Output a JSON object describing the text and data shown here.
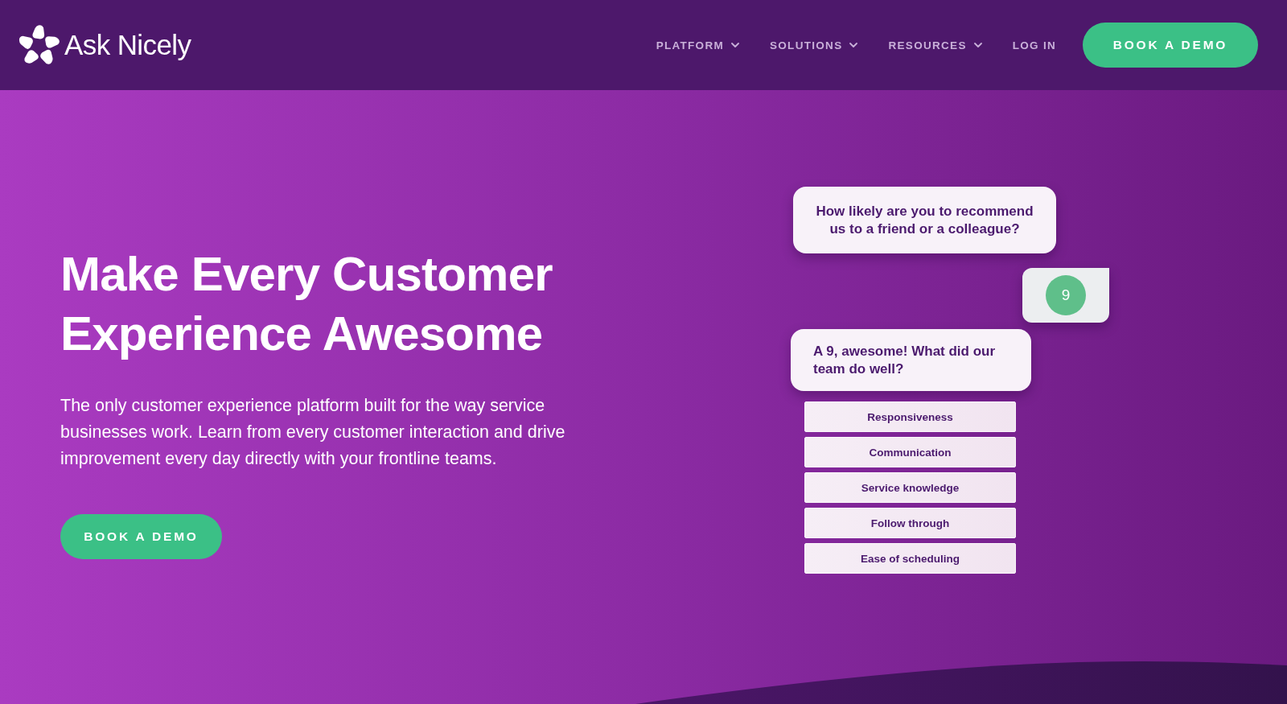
{
  "header": {
    "brand": "Ask Nicely",
    "nav": [
      {
        "label": "PLATFORM",
        "kind": "dropdown"
      },
      {
        "label": "SOLUTIONS",
        "kind": "dropdown"
      },
      {
        "label": "RESOURCES",
        "kind": "dropdown"
      },
      {
        "label": "LOG IN",
        "kind": "link"
      }
    ],
    "cta": "BOOK A DEMO"
  },
  "hero": {
    "heading": "Make Every Customer Experience Awesome",
    "description": "The only customer experience platform built for the way service businesses work. Learn from every customer interaction and drive improvement every day directly with your frontline teams.",
    "cta": "BOOK A DEMO"
  },
  "survey": {
    "question": "How likely are you to recommend us to a friend or a colleague?",
    "score": "9",
    "follow_up": "A 9, awesome! What did our team do well?",
    "options": [
      "Responsiveness",
      "Communication",
      "Service knowledge",
      "Follow through",
      "Ease of scheduling"
    ]
  }
}
